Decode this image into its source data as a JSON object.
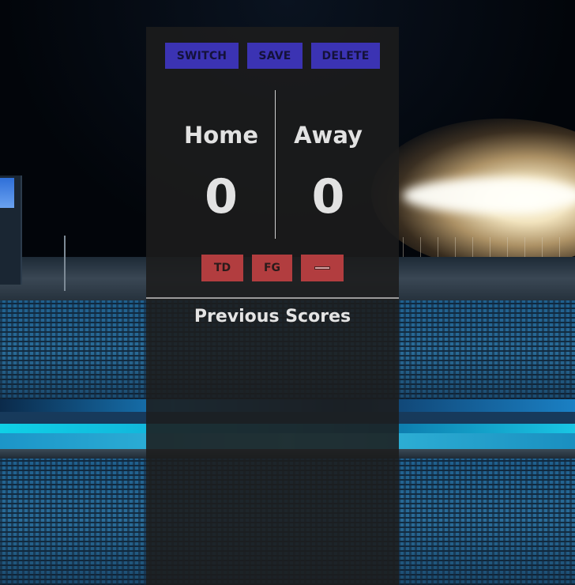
{
  "toolbar": {
    "switch_label": "SWITCH",
    "save_label": "SAVE",
    "delete_label": "DELETE"
  },
  "teams": {
    "home": {
      "name": "Home",
      "score": "0"
    },
    "away": {
      "name": "Away",
      "score": "0"
    }
  },
  "score_actions": {
    "td_label": "TD",
    "fg_label": "FG",
    "minus_icon": "minus-icon"
  },
  "previous_scores": {
    "title": "Previous Scores",
    "items": []
  },
  "colors": {
    "toolbar_button": "#3b33b3",
    "score_button": "#b23d3f",
    "panel": "#1c1c1c",
    "text": "#e2e2e2"
  }
}
